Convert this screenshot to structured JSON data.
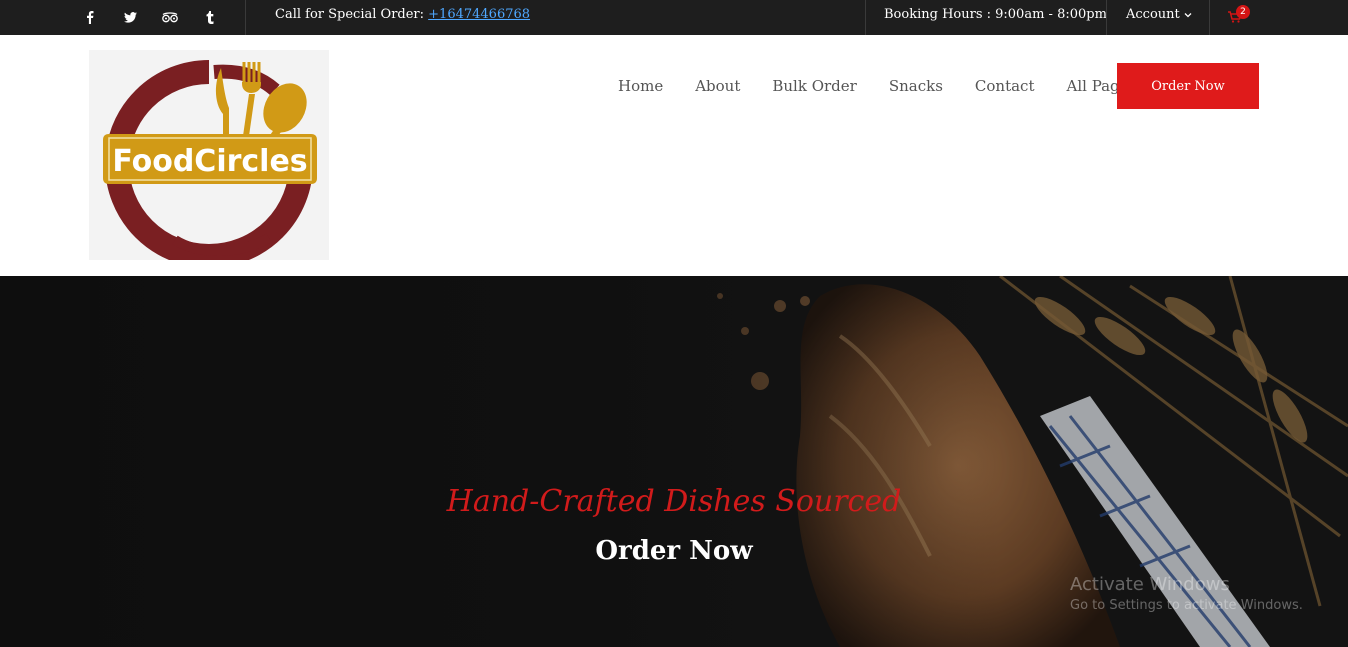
{
  "topbar": {
    "social_icons": [
      "facebook-icon",
      "twitter-icon",
      "tripadvisor-icon",
      "tumblr-icon"
    ],
    "special_order_label": "Call for Special Order:",
    "phone": "+16474466768",
    "booking_hours": "Booking Hours : 9:00am - 8:00pm",
    "account_label": "Account",
    "cart_count": "2"
  },
  "header": {
    "logo_text": "FoodCircles",
    "nav": [
      {
        "label": "Home"
      },
      {
        "label": "About"
      },
      {
        "label": "Bulk Order"
      },
      {
        "label": "Snacks"
      },
      {
        "label": "Contact"
      },
      {
        "label": "All Pages"
      }
    ],
    "order_button": "Order Now"
  },
  "hero": {
    "tagline": "Hand-Crafted Dishes Sourced",
    "cta": "Order Now"
  },
  "watermark": {
    "title": "Activate Windows",
    "subtitle": "Go to Settings to activate Windows."
  },
  "colors": {
    "accent_red": "#df1b1b",
    "topbar_bg": "#1e1e1e",
    "link_blue": "#4fa8ff",
    "logo_maroon": "#7a1f22",
    "logo_gold": "#d19a16"
  }
}
